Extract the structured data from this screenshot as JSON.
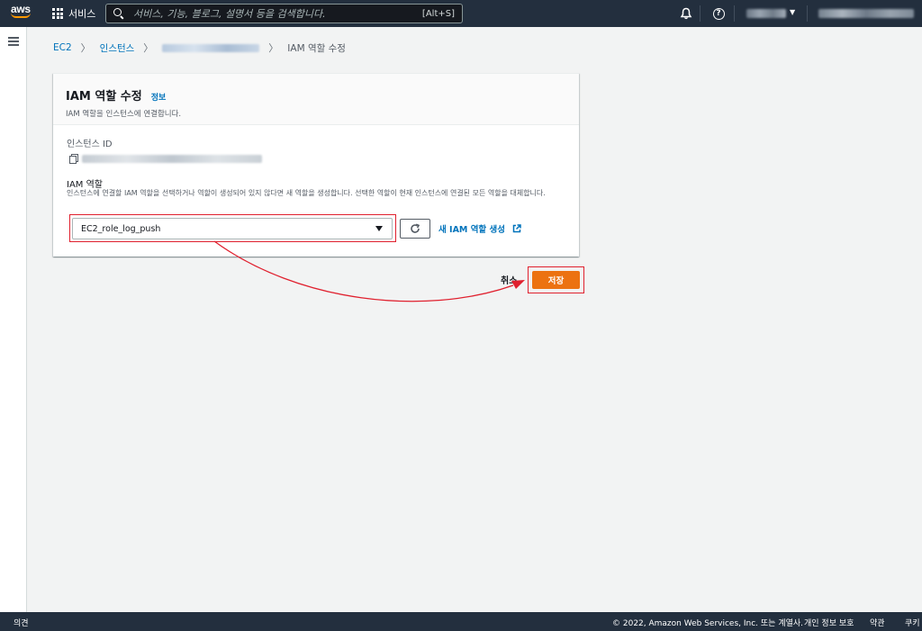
{
  "topnav": {
    "logo_text": "aws",
    "services_label": "서비스",
    "search_placeholder": "서비스, 기능, 블로그, 설명서 등을 검색합니다.",
    "search_shortcut": "[Alt+S]"
  },
  "breadcrumb": {
    "items": [
      "EC2",
      "인스턴스"
    ],
    "current": "IAM 역할 수정"
  },
  "panel": {
    "title": "IAM 역할 수정",
    "info_link": "정보",
    "description": "IAM 역할을 인스턴스에 연결합니다.",
    "instance_id_label": "인스턴스 ID",
    "role_label": "IAM 역할",
    "role_description": "인스턴스에 연결할 IAM 역할을 선택하거나 역할이 생성되어 있지 않다면 새 역할을 생성합니다. 선택한 역할이 현재 인스턴스에 연결된 모든 역할을 대체합니다.",
    "role_selected": "EC2_role_log_push",
    "create_role_link": "새 IAM 역할 생성"
  },
  "actions": {
    "cancel_label": "취소",
    "save_label": "저장"
  },
  "footer": {
    "feedback": "의견",
    "copyright": "© 2022, Amazon Web Services, Inc. 또는 계열사.",
    "privacy": "개인 정보 보호",
    "terms": "약관",
    "cookie": "쿠키"
  },
  "colors": {
    "nav_bg": "#232f3e",
    "link": "#0073bb",
    "primary_button": "#ec7211",
    "highlight": "#e0202e"
  }
}
